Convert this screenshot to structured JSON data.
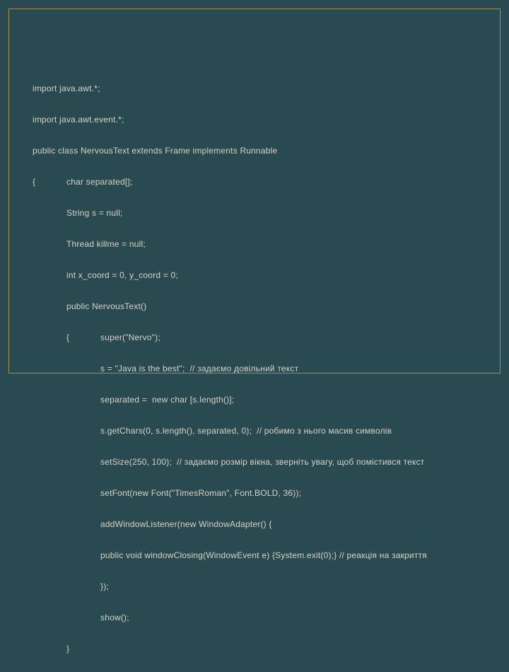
{
  "code": {
    "l0": "import java.awt.*;",
    "l1": "import java.awt.event.*;",
    "l2": "public class NervousText extends Frame implements Runnable",
    "l3a": "{",
    "l3b": "char separated[];",
    "l4": "String s = null;",
    "l5": "Thread killme = null;",
    "l6": "int x_coord = 0, y_coord = 0;",
    "l7": "public NervousText()",
    "l8a": "{",
    "l8b": "super(\"Nervo\");",
    "l9": "s = \"Java is the best\";  // задаємо довільний текст",
    "l10": "separated =  new char [s.length()];",
    "l11": "s.getChars(0, s.length(), separated, 0);  // робимо з нього масив символів",
    "l12": "setSize(250, 100);  // задаємо розмір вікна, зверніть увагу, щоб помістився текст",
    "l13": "setFont(new Font(\"TimesRoman\", Font.BOLD, 36));",
    "l14": "addWindowListener(new WindowAdapter() {",
    "l15": "public void windowClosing(WindowEvent e) {System.exit(0);} // реакція на закриття",
    "l16": "});",
    "l17": "show();",
    "l18": "}"
  }
}
